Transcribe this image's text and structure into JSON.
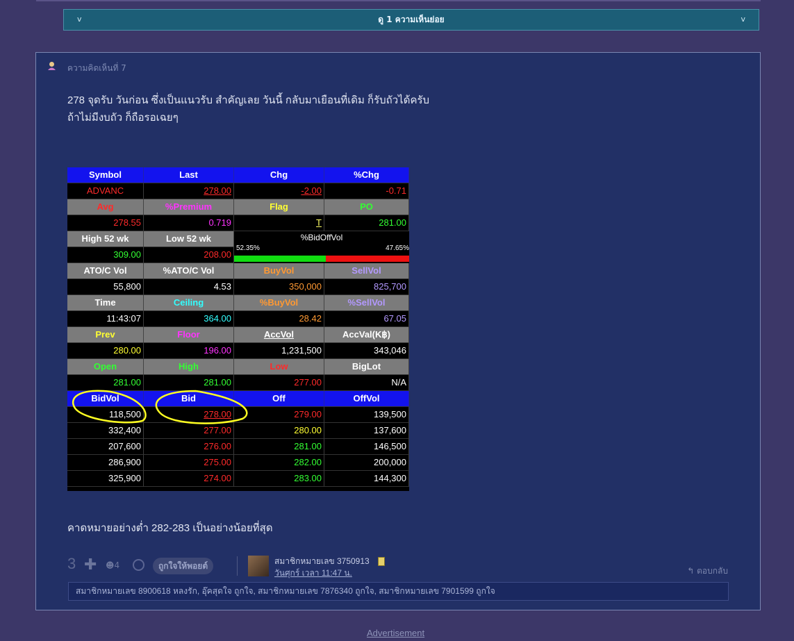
{
  "subcomment_bar": {
    "label": "ดู 1 ความเห็นย่อย",
    "chev_left": "v",
    "chev_right": "v"
  },
  "comment": {
    "number_label": "ความคิดเห็นที่ 7",
    "icon": "user-icon",
    "body_lines": [
      "278 จุดรับ วันก่อน ซึ่งเป็นแนวรับ สำคัญเลย  วันนี้ กลับมาเยือนที่เดิม ก็รับถัวได้ครับ",
      "ถ้าไม่มีงบถัว ก็ถือรอเฉยๆ"
    ],
    "tail_text": "คาดหมายอย่างต่ำ 282-283 เป็นอย่างน้อยที่สุด",
    "votes": "3",
    "plus_label": "✚",
    "small_count": "☻4",
    "like_button": "ถูกใจให้พอยต์",
    "member": "สมาชิกหมายเลข 3750913",
    "date": "วันศุกร์ เวลา 11:47 น.",
    "reply": "ตอบกลับ",
    "likers": "สมาชิกหมายเลข 8900618 หลงรัก, อุ๊คสุดใจ ถูกใจ, สมาชิกหมายเลข 7876340 ถูกใจ, สมาชิกหมายเลข 7901599 ถูกใจ"
  },
  "stock": {
    "bidoffvol": {
      "title": "%BidOffVol",
      "bid_pct": "52.35%",
      "off_pct": "47.65%",
      "bid_fraction": 0.5235
    },
    "rows": [
      [
        {
          "t": "Symbol",
          "s": "hb"
        },
        {
          "t": "Last",
          "s": "hb"
        },
        {
          "t": "Chg",
          "s": "hb"
        },
        {
          "t": "%Chg",
          "s": "hb"
        }
      ],
      [
        {
          "t": "ADVANC",
          "s": "v",
          "c": "#ff2a2a",
          "a": "center"
        },
        {
          "t": "278.00",
          "s": "v",
          "c": "#ff2a2a",
          "u": 1
        },
        {
          "t": "-2.00",
          "s": "v",
          "c": "#ff2a2a",
          "u": 1
        },
        {
          "t": "-0.71",
          "s": "v",
          "c": "#ff2a2a"
        }
      ],
      [
        {
          "t": "Avg",
          "s": "h",
          "c": "#ff2a2a"
        },
        {
          "t": "%Premium",
          "s": "h",
          "c": "#ff33ff"
        },
        {
          "t": "Flag",
          "s": "h",
          "c": "#ffff33"
        },
        {
          "t": "PO",
          "s": "h",
          "c": "#33ff33"
        }
      ],
      [
        {
          "t": "278.55",
          "s": "v",
          "c": "#ff2a2a"
        },
        {
          "t": "0.719",
          "s": "v",
          "c": "#ff33ff"
        },
        {
          "t": "T",
          "s": "v",
          "c": "#ffff66",
          "u": 1
        },
        {
          "t": "281.00",
          "s": "v",
          "c": "#33ff33"
        }
      ],
      [
        {
          "t": "High 52 wk",
          "s": "h"
        },
        {
          "t": "Low 52 wk",
          "s": "h"
        },
        null,
        null
      ],
      [
        {
          "t": "309.00",
          "s": "v",
          "c": "#33ff33"
        },
        {
          "t": "208.00",
          "s": "v",
          "c": "#ff2a2a"
        },
        null,
        null
      ],
      [
        {
          "t": "ATO/C Vol",
          "s": "h"
        },
        {
          "t": "%ATO/C Vol",
          "s": "h"
        },
        {
          "t": "BuyVol",
          "s": "h",
          "c": "#ff9933"
        },
        {
          "t": "SellVol",
          "s": "h",
          "c": "#b399ff"
        }
      ],
      [
        {
          "t": "55,800",
          "s": "v",
          "c": "#ffffff"
        },
        {
          "t": "4.53",
          "s": "v",
          "c": "#ffffff"
        },
        {
          "t": "350,000",
          "s": "v",
          "c": "#ff9933"
        },
        {
          "t": "825,700",
          "s": "v",
          "c": "#b399ff"
        }
      ],
      [
        {
          "t": "Time",
          "s": "h"
        },
        {
          "t": "Ceiling",
          "s": "h",
          "c": "#33ffff"
        },
        {
          "t": "%BuyVol",
          "s": "h",
          "c": "#ff9933"
        },
        {
          "t": "%SellVol",
          "s": "h",
          "c": "#b399ff"
        }
      ],
      [
        {
          "t": "11:43:07",
          "s": "v",
          "c": "#ffffff"
        },
        {
          "t": "364.00",
          "s": "v",
          "c": "#33ffff"
        },
        {
          "t": "28.42",
          "s": "v",
          "c": "#ff9933"
        },
        {
          "t": "67.05",
          "s": "v",
          "c": "#b399ff"
        }
      ],
      [
        {
          "t": "Prev",
          "s": "h",
          "c": "#ffff33"
        },
        {
          "t": "Floor",
          "s": "h",
          "c": "#ff33ff"
        },
        {
          "t": "AccVol",
          "s": "h",
          "u": 1
        },
        {
          "t": "AccVal(K฿)",
          "s": "h"
        }
      ],
      [
        {
          "t": "280.00",
          "s": "v",
          "c": "#ffff33"
        },
        {
          "t": "196.00",
          "s": "v",
          "c": "#ff33ff"
        },
        {
          "t": "1,231,500",
          "s": "v",
          "c": "#ffffff"
        },
        {
          "t": "343,046",
          "s": "v",
          "c": "#ffffff"
        }
      ],
      [
        {
          "t": "Open",
          "s": "h",
          "c": "#33ff33"
        },
        {
          "t": "High",
          "s": "h",
          "c": "#33ff33"
        },
        {
          "t": "Low",
          "s": "h",
          "c": "#ff2a2a"
        },
        {
          "t": "BigLot",
          "s": "h"
        }
      ],
      [
        {
          "t": "281.00",
          "s": "v",
          "c": "#33ff33"
        },
        {
          "t": "281.00",
          "s": "v",
          "c": "#33ff33"
        },
        {
          "t": "277.00",
          "s": "v",
          "c": "#ff2a2a"
        },
        {
          "t": "N/A",
          "s": "v",
          "c": "#ffffff"
        }
      ],
      [
        {
          "t": "BidVol",
          "s": "hb"
        },
        {
          "t": "Bid",
          "s": "hb"
        },
        {
          "t": "Off",
          "s": "hb"
        },
        {
          "t": "OffVol",
          "s": "hb"
        }
      ],
      [
        {
          "t": "118,500",
          "s": "v",
          "c": "#ffffff"
        },
        {
          "t": "278.00",
          "s": "v",
          "c": "#ff2a2a",
          "u": 1
        },
        {
          "t": "279.00",
          "s": "v",
          "c": "#ff2a2a"
        },
        {
          "t": "139,500",
          "s": "v",
          "c": "#ffffff"
        }
      ],
      [
        {
          "t": "332,400",
          "s": "v",
          "c": "#ffffff"
        },
        {
          "t": "277.00",
          "s": "v",
          "c": "#ff2a2a"
        },
        {
          "t": "280.00",
          "s": "v",
          "c": "#ffff33"
        },
        {
          "t": "137,600",
          "s": "v",
          "c": "#ffffff"
        }
      ],
      [
        {
          "t": "207,600",
          "s": "v",
          "c": "#ffffff"
        },
        {
          "t": "276.00",
          "s": "v",
          "c": "#ff2a2a"
        },
        {
          "t": "281.00",
          "s": "v",
          "c": "#33ff33"
        },
        {
          "t": "146,500",
          "s": "v",
          "c": "#ffffff"
        }
      ],
      [
        {
          "t": "286,900",
          "s": "v",
          "c": "#ffffff"
        },
        {
          "t": "275.00",
          "s": "v",
          "c": "#ff2a2a"
        },
        {
          "t": "282.00",
          "s": "v",
          "c": "#33ff33"
        },
        {
          "t": "200,000",
          "s": "v",
          "c": "#ffffff"
        }
      ],
      [
        {
          "t": "325,900",
          "s": "v",
          "c": "#ffffff"
        },
        {
          "t": "274.00",
          "s": "v",
          "c": "#ff2a2a"
        },
        {
          "t": "283.00",
          "s": "v",
          "c": "#33ff33"
        },
        {
          "t": "144,300",
          "s": "v",
          "c": "#ffffff"
        }
      ]
    ]
  },
  "advertisement": "Advertisement"
}
